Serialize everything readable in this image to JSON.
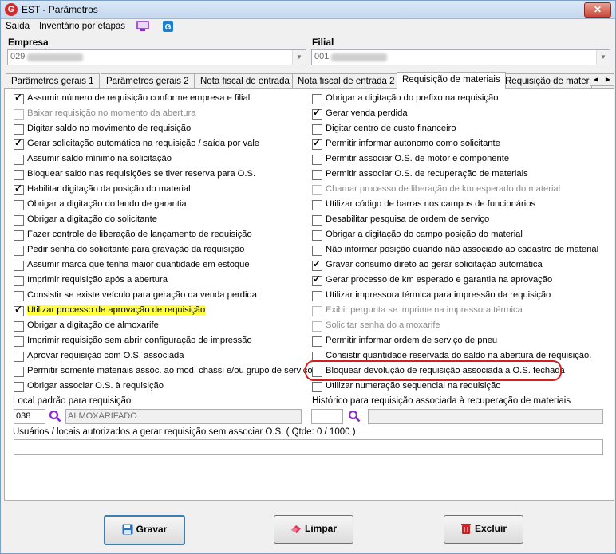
{
  "window": {
    "title": "EST - Parâmetros",
    "close": "✕"
  },
  "menu": {
    "items": [
      "Saída",
      "Inventário por etapas"
    ]
  },
  "empresa": {
    "label": "Empresa",
    "value": "029"
  },
  "filial": {
    "label": "Filial",
    "value": "001"
  },
  "tabs": [
    "Parâmetros gerais 1",
    "Parâmetros gerais 2",
    "Nota fiscal de entrada",
    "Nota fiscal de entrada 2",
    "Requisição de materiais",
    "Requisição de materi"
  ],
  "left_options": [
    {
      "label": "Assumir número de requisição conforme empresa e filial",
      "checked": true,
      "enabled": true
    },
    {
      "label": "Baixar requisição no momento da abertura",
      "checked": false,
      "enabled": false
    },
    {
      "label": "Digitar saldo no movimento de requisição",
      "checked": false,
      "enabled": true
    },
    {
      "label": "Gerar solicitação automática na requisição / saída por vale",
      "checked": true,
      "enabled": true
    },
    {
      "label": "Assumir saldo mínimo na solicitação",
      "checked": false,
      "enabled": true
    },
    {
      "label": "Bloquear saldo nas requisições se tiver reserva para O.S.",
      "checked": false,
      "enabled": true
    },
    {
      "label": "Habilitar digitação da posição do material",
      "checked": true,
      "enabled": true
    },
    {
      "label": "Obrigar a digitação do laudo de garantia",
      "checked": false,
      "enabled": true
    },
    {
      "label": "Obrigar a digitação do solicitante",
      "checked": false,
      "enabled": true
    },
    {
      "label": "Fazer controle de liberação de lançamento de requisição",
      "checked": false,
      "enabled": true
    },
    {
      "label": "Pedir senha do solicitante para gravação da requisição",
      "checked": false,
      "enabled": true
    },
    {
      "label": "Assumir marca que tenha maior quantidade em estoque",
      "checked": false,
      "enabled": true
    },
    {
      "label": "Imprimir requisição após a abertura",
      "checked": false,
      "enabled": true
    },
    {
      "label": "Consistir se existe veículo para geração da venda perdida",
      "checked": false,
      "enabled": true
    },
    {
      "label": "Utilizar processo de aprovação de requisição",
      "checked": true,
      "enabled": true,
      "highlight": true
    },
    {
      "label": "Obrigar a digitação de almoxarife",
      "checked": false,
      "enabled": true
    },
    {
      "label": "Imprimir requisição sem abrir configuração de impressão",
      "checked": false,
      "enabled": true
    },
    {
      "label": "Aprovar requisição com O.S. associada",
      "checked": false,
      "enabled": true
    },
    {
      "label": "Permitir somente materiais assoc. ao mod. chassi e/ou grupo de serviço",
      "checked": false,
      "enabled": true
    },
    {
      "label": "Obrigar associar O.S. à requisição",
      "checked": false,
      "enabled": true
    }
  ],
  "right_options": [
    {
      "label": "Obrigar a digitação do prefixo na requisição",
      "checked": false,
      "enabled": true
    },
    {
      "label": "Gerar venda perdida",
      "checked": true,
      "enabled": true
    },
    {
      "label": "Digitar centro de custo financeiro",
      "checked": false,
      "enabled": true
    },
    {
      "label": "Permitir informar autonomo como solicitante",
      "checked": true,
      "enabled": true
    },
    {
      "label": "Permitir associar O.S. de motor e componente",
      "checked": false,
      "enabled": true
    },
    {
      "label": "Permitir associar O.S. de recuperação de materiais",
      "checked": false,
      "enabled": true
    },
    {
      "label": "Chamar processo de liberação de km esperado do material",
      "checked": false,
      "enabled": false
    },
    {
      "label": "Utilizar código de barras nos campos de funcionários",
      "checked": false,
      "enabled": true
    },
    {
      "label": "Desabilitar pesquisa de ordem de serviço",
      "checked": false,
      "enabled": true
    },
    {
      "label": "Obrigar a digitação do campo posição do material",
      "checked": false,
      "enabled": true
    },
    {
      "label": "Não informar posição quando não associado ao cadastro de material",
      "checked": false,
      "enabled": true
    },
    {
      "label": "Gravar consumo direto ao gerar solicitação automática",
      "checked": true,
      "enabled": true
    },
    {
      "label": "Gerar processo de km esperado e garantia na aprovação",
      "checked": true,
      "enabled": true,
      "circled": true
    },
    {
      "label": "Utilizar impressora térmica para impressão da requisição",
      "checked": false,
      "enabled": true
    },
    {
      "label": "Exibir pergunta se imprime na impressora térmica",
      "checked": false,
      "enabled": false
    },
    {
      "label": "Solicitar senha do almoxarife",
      "checked": false,
      "enabled": false
    },
    {
      "label": "Permitir informar ordem de serviço de pneu",
      "checked": false,
      "enabled": true
    },
    {
      "label": "Consistir quantidade reservada do saldo na abertura de requisição.",
      "checked": false,
      "enabled": true
    },
    {
      "label": "Bloquear devolução de requisição associada a O.S. fechada",
      "checked": false,
      "enabled": true
    },
    {
      "label": "Utilizar numeração sequencial na requisição",
      "checked": false,
      "enabled": true
    }
  ],
  "local_padrao": {
    "label": "Local padrão para requisição",
    "code": "038",
    "description": "ALMOXARIFADO"
  },
  "historico": {
    "label": "Histórico para requisição associada à recuperação de materiais",
    "code": "",
    "description": ""
  },
  "usuarios": {
    "label": "Usuários / locais autorizados a gerar requisição sem associar O.S.   ( Qtde: 0 / 1000 )"
  },
  "buttons": {
    "save": "Gravar",
    "clear": "Limpar",
    "delete": "Excluir"
  },
  "colors": {
    "highlight": "#ffff3a",
    "annotation": "#d22020",
    "delete_icon": "#d42020",
    "save_icon": "#2a6fc0"
  }
}
